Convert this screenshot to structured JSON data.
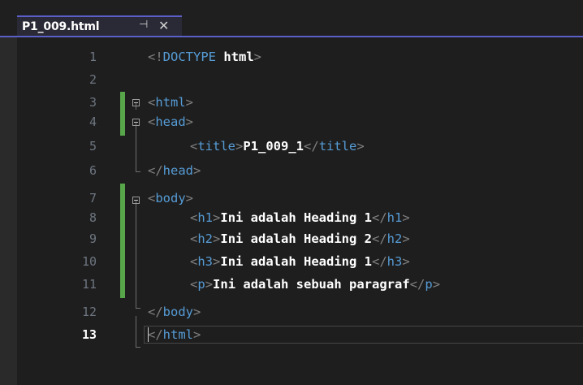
{
  "tab": {
    "title": "P1_009.html",
    "pin_glyph": "⊣",
    "close_glyph": "✕"
  },
  "colors": {
    "accent": "#5b5fc7",
    "tag": "#569cd6",
    "bracket": "#808080",
    "text": "#ffffff",
    "line_number": "#6e7681",
    "changed_bar": "#57a64a",
    "background": "#1e1e1e"
  },
  "editor": {
    "current_line": "13",
    "lines": [
      {
        "num": "1",
        "open": "<!",
        "tag": "DOCTYPE",
        "mid": " ",
        "text": "html",
        "close": ">"
      },
      {
        "num": "2"
      },
      {
        "num": "3",
        "open": "<",
        "tag": "html",
        "close": ">"
      },
      {
        "num": "4",
        "open": "<",
        "tag": "head",
        "close": ">"
      },
      {
        "num": "5",
        "open": "<",
        "tag": "title",
        "close": ">",
        "text": "P1_009_1",
        "open2": "</",
        "tag2": "title",
        "close2": ">"
      },
      {
        "num": "6",
        "open": "</",
        "tag": "head",
        "close": ">"
      },
      {
        "num": "7",
        "open": "<",
        "tag": "body",
        "close": ">"
      },
      {
        "num": "8",
        "open": "<",
        "tag": "h1",
        "close": ">",
        "text": "Ini adalah Heading 1",
        "open2": "</",
        "tag2": "h1",
        "close2": ">"
      },
      {
        "num": "9",
        "open": "<",
        "tag": "h2",
        "close": ">",
        "text": "Ini adalah Heading 2",
        "open2": "</",
        "tag2": "h2",
        "close2": ">"
      },
      {
        "num": "10",
        "open": "<",
        "tag": "h3",
        "close": ">",
        "text": "Ini adalah Heading 1",
        "open2": "</",
        "tag2": "h3",
        "close2": ">"
      },
      {
        "num": "11",
        "open": "<",
        "tag": "p",
        "close": ">",
        "text": "Ini adalah sebuah paragraf",
        "open2": "</",
        "tag2": "p",
        "close2": ">"
      },
      {
        "num": "12",
        "open": "</",
        "tag": "body",
        "close": ">"
      },
      {
        "num": "13",
        "open": "</",
        "tag": "html",
        "close": ">"
      }
    ]
  }
}
